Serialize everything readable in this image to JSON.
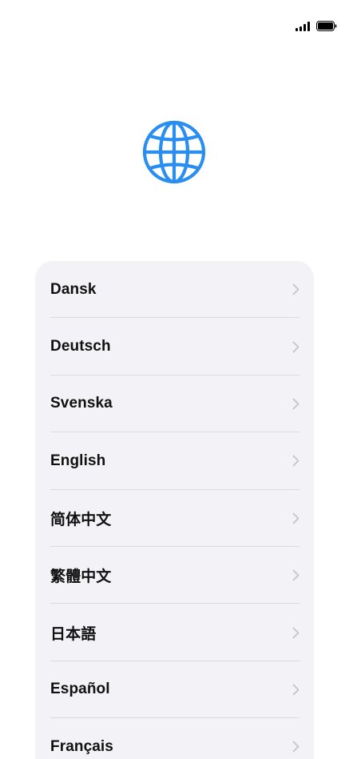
{
  "status_bar": {
    "signal_icon": "cellular-signal-icon",
    "battery_icon": "battery-icon"
  },
  "header": {
    "icon": "globe-icon",
    "accent_color": "#2a8df0"
  },
  "languages": [
    {
      "label": "Dansk"
    },
    {
      "label": "Deutsch"
    },
    {
      "label": "Svenska"
    },
    {
      "label": "English"
    },
    {
      "label": "简体中文"
    },
    {
      "label": "繁體中文"
    },
    {
      "label": "日本語"
    },
    {
      "label": "Español"
    },
    {
      "label": "Français"
    }
  ],
  "colors": {
    "card_background": "#f2f2f7",
    "separator": "#d9d9de",
    "chevron": "#c4c4c9",
    "text": "#111111"
  }
}
